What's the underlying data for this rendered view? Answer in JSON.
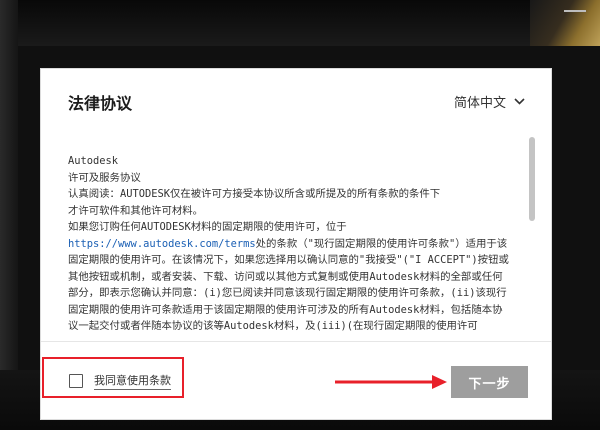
{
  "dialog": {
    "title": "法律协议",
    "language": {
      "selected": "简体中文"
    },
    "agreement": {
      "lines": [
        "Autodesk",
        "许可及服务协议",
        "认真阅读：AUTODESK仅在被许可方接受本协议所含或所提及的所有条款的条件下",
        "才许可软件和其他许可材料。",
        "如果您订购任何AUTODESK材料的固定期限的使用许可，位于"
      ],
      "link": "https://www.autodesk.com/terms",
      "after_link": "处的条款（\"现行固定期限的使用许可条款\"）适用于该固定期限的使用许可。在该情况下，如果您选择用以确认同意的\"我接受\"(\"I ACCEPT\")按钮或其他按钮或机制，或者安装、下载、访问或以其他方式复制或使用Autodesk材料的全部或任何部分，即表示您确认并同意：(i)您已阅读并同意该现行固定期限的使用许可条款，(ii)该现行固定期限的使用许可条款适用于该固定期限的使用许可涉及的所有Autodesk材料，包括随本协议一起交付或者伴随本协议的该等Autodesk材料，及(iii)(在现行固定期限的使用许可"
    },
    "agree_label": "我同意使用条款",
    "next_label": "下一步"
  },
  "colors": {
    "annotation": "#e8202a",
    "button_disabled": "#9e9e9e",
    "link": "#1a5fb4"
  }
}
